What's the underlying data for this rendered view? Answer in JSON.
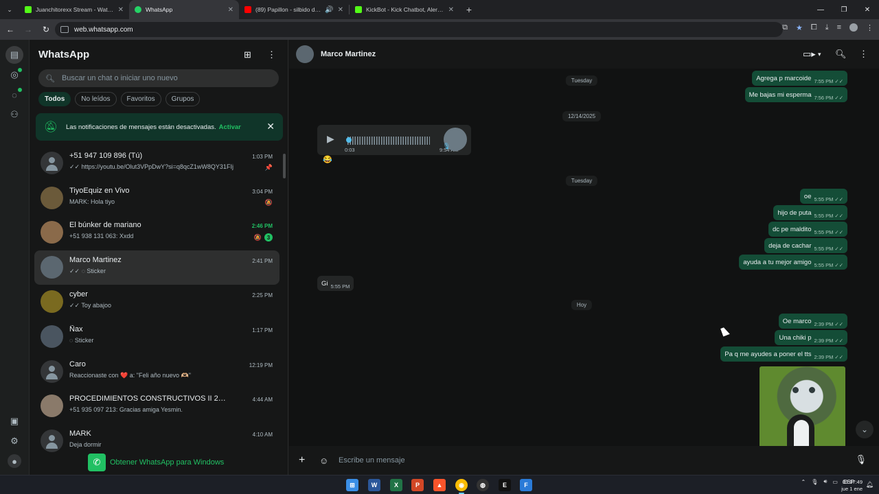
{
  "browser": {
    "tabs": [
      {
        "title": "Juanchitorexx Stream - Watch L",
        "color": "#53fc18",
        "active": false
      },
      {
        "title": "WhatsApp",
        "color": "#25d366",
        "active": true
      },
      {
        "title": "(89) Papillon - silbido de ar",
        "color": "#ff0000",
        "active": false
      },
      {
        "title": "KickBot - Kick Chatbot, Alerts, T",
        "color": "#53fc18",
        "active": false
      }
    ],
    "url": "web.whatsapp.com"
  },
  "panel": {
    "title": "WhatsApp",
    "search_placeholder": "Buscar un chat o iniciar uno nuevo",
    "filters": [
      "Todos",
      "No leídos",
      "Favoritos",
      "Grupos"
    ],
    "notice": {
      "text": "Las notificaciones de mensajes están desactivadas.",
      "action": "Activar"
    },
    "get_app": "Obtener WhatsApp para Windows",
    "chats": [
      {
        "name": "+51 947 109 896 (Tú)",
        "msg": "✓✓ https://youtu.be/Olut3VPpDwY?si=q8qcZ1wW8QY31FIj",
        "time": "1:03 PM",
        "side": "📌",
        "avatar": "gray"
      },
      {
        "name": "TiyoEquiz en Vivo",
        "msg": "MARK: Hola tiyo",
        "time": "3:04 PM",
        "side": "🔕",
        "avatar": "#6b5a3a"
      },
      {
        "name": "El búnker de mariano",
        "msg": "+51 938 131 063: Xxdd",
        "time": "2:46 PM",
        "side": "🔕",
        "badge": "3",
        "avatar": "#8a6a4a"
      },
      {
        "name": "Marco Martinez",
        "msg": "✓✓ ◌ Sticker",
        "time": "2:41 PM",
        "avatar": "#5b6770"
      },
      {
        "name": "cyber",
        "msg": "✓✓ Toy abajoo",
        "time": "2:25 PM",
        "avatar": "#7a6a20"
      },
      {
        "name": "Ñax",
        "msg": "◌ Sticker",
        "time": "1:17 PM",
        "avatar": "#4a5560"
      },
      {
        "name": "Caro",
        "msg": "Reaccionaste con ❤️ a: \"Feli año nuevo 🫶🏼\"",
        "time": "12:19 PM",
        "avatar": "gray"
      },
      {
        "name": "PROCEDIMIENTOS CONSTRUCTIVOS II 2025",
        "msg": "+51 935 097 213: Gracias amiga Yesmin.",
        "time": "4:44 AM",
        "avatar": "#8a7a6a"
      },
      {
        "name": "MARK",
        "msg": "Deja dormir",
        "time": "4:10 AM",
        "avatar": "gray"
      }
    ]
  },
  "conversation": {
    "contact": "Marco Martinez",
    "composer_placeholder": "Escribe un mensaje",
    "days": [
      "Tuesday",
      "12/14/2025",
      "Tuesday",
      "Hoy"
    ],
    "voice": {
      "duration": "0:03",
      "time": "9:54 AM",
      "reaction": "😂"
    },
    "messages_a": [
      {
        "text": "Agrega p marcoide",
        "time": "7:55 PM"
      },
      {
        "text": "Me bajas mi esperma",
        "time": "7:56 PM"
      }
    ],
    "messages_b": [
      {
        "text": "oe",
        "time": "5:55 PM"
      },
      {
        "text": "hijo de puta",
        "time": "5:55 PM"
      },
      {
        "text": "dc pe maldito",
        "time": "5:55 PM"
      },
      {
        "text": "deja de cachar",
        "time": "5:55 PM"
      },
      {
        "text": "ayuda a tu mejor amigo",
        "time": "5:55 PM"
      }
    ],
    "incoming": {
      "text": "Gi",
      "time": "5:55 PM"
    },
    "messages_c": [
      {
        "text": "Oe marco",
        "time": "2:39 PM"
      },
      {
        "text": "Una chiki p",
        "time": "2:39 PM"
      },
      {
        "text": "Pa q me ayudes a poner el tts",
        "time": "2:39 PM"
      }
    ]
  },
  "taskbar": {
    "lang": "ESP",
    "time": "03:07:49",
    "date": "jue 1 ene"
  }
}
